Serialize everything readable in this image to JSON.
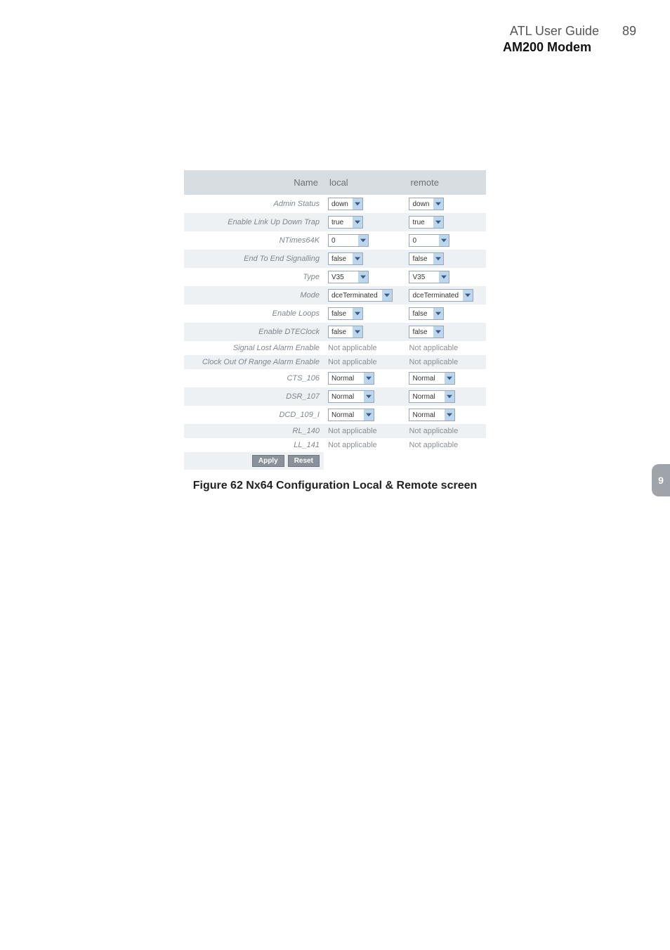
{
  "header": {
    "title": "ATL User Guide",
    "page_number": "89",
    "subtitle": "AM200 Modem"
  },
  "side_tab": "9",
  "table": {
    "columns": {
      "name": "Name",
      "local": "local",
      "remote": "remote"
    },
    "rows": [
      {
        "label": "Admin Status",
        "local": {
          "type": "select",
          "value": "down"
        },
        "remote": {
          "type": "select",
          "value": "down"
        }
      },
      {
        "label": "Enable Link Up Down Trap",
        "local": {
          "type": "select",
          "value": "true"
        },
        "remote": {
          "type": "select",
          "value": "true"
        }
      },
      {
        "label": "NTimes64K",
        "local": {
          "type": "select",
          "value": "0"
        },
        "remote": {
          "type": "select",
          "value": "0"
        }
      },
      {
        "label": "End To End Signalling",
        "local": {
          "type": "select",
          "value": "false"
        },
        "remote": {
          "type": "select",
          "value": "false"
        }
      },
      {
        "label": "Type",
        "local": {
          "type": "select",
          "value": "V35"
        },
        "remote": {
          "type": "select",
          "value": "V35"
        }
      },
      {
        "label": "Mode",
        "local": {
          "type": "select",
          "value": "dceTerminated"
        },
        "remote": {
          "type": "select",
          "value": "dceTerminated"
        }
      },
      {
        "label": "Enable Loops",
        "local": {
          "type": "select",
          "value": "false"
        },
        "remote": {
          "type": "select",
          "value": "false"
        }
      },
      {
        "label": "Enable DTEClock",
        "local": {
          "type": "select",
          "value": "false"
        },
        "remote": {
          "type": "select",
          "value": "false"
        }
      },
      {
        "label": "Signal Lost Alarm Enable",
        "local": {
          "type": "text",
          "value": "Not applicable"
        },
        "remote": {
          "type": "text",
          "value": "Not applicable"
        }
      },
      {
        "label": "Clock Out Of Range Alarm Enable",
        "local": {
          "type": "text",
          "value": "Not applicable"
        },
        "remote": {
          "type": "text",
          "value": "Not applicable"
        }
      },
      {
        "label": "CTS_106",
        "local": {
          "type": "select",
          "value": "Normal"
        },
        "remote": {
          "type": "select",
          "value": "Normal"
        }
      },
      {
        "label": "DSR_107",
        "local": {
          "type": "select",
          "value": "Normal"
        },
        "remote": {
          "type": "select",
          "value": "Normal"
        }
      },
      {
        "label": "DCD_109_I",
        "local": {
          "type": "select",
          "value": "Normal"
        },
        "remote": {
          "type": "select",
          "value": "Normal"
        }
      },
      {
        "label": "RL_140",
        "local": {
          "type": "text",
          "value": "Not applicable"
        },
        "remote": {
          "type": "text",
          "value": "Not applicable"
        }
      },
      {
        "label": "LL_141",
        "local": {
          "type": "text",
          "value": "Not applicable"
        },
        "remote": {
          "type": "text",
          "value": "Not applicable"
        }
      }
    ],
    "buttons": {
      "apply": "Apply",
      "reset": "Reset"
    }
  },
  "caption": "Figure 62 Nx64 Configuration Local & Remote screen"
}
